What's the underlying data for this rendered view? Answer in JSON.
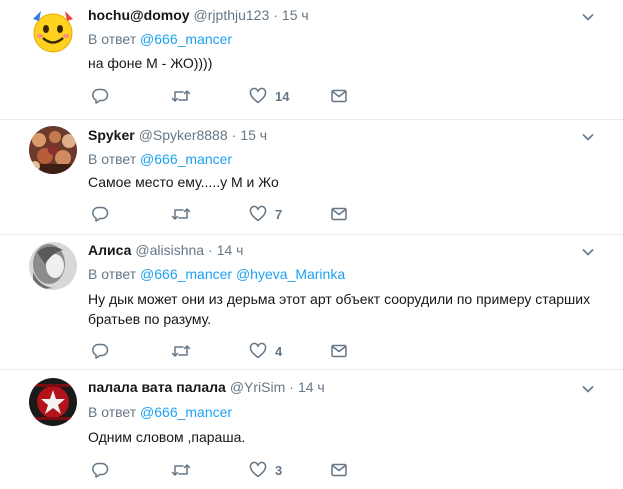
{
  "tweets": [
    {
      "name": "hochu@domoy",
      "handle": "@rjpthju123",
      "separator": "·",
      "time": "15 ч",
      "reply_prefix": "В ответ",
      "mentions": "@666_mancer",
      "text": "на фоне М - ЖО))))",
      "like_count": "14",
      "avatar_icon": "emoji-face-avatar"
    },
    {
      "name": "Spyker",
      "handle": "@Spyker8888",
      "separator": "·",
      "time": "15 ч",
      "reply_prefix": "В ответ",
      "mentions": "@666_mancer",
      "text": "Самое место ему.....у  М и Жо",
      "like_count": "7",
      "avatar_icon": "crowd-photo-avatar"
    },
    {
      "name": "Алиса",
      "handle": "@alisishna",
      "separator": "·",
      "time": "14 ч",
      "reply_prefix": "В ответ",
      "mentions": "@666_mancer @hyeva_Marinka",
      "text": "Ну дык может они из дерьма этот арт объект соорудили по примеру старших братьев по разуму.",
      "like_count": "4",
      "avatar_icon": "bw-portrait-avatar"
    },
    {
      "name": "палала вата палала",
      "handle": "@YriSim",
      "separator": "·",
      "time": "14 ч",
      "reply_prefix": "В ответ",
      "mentions": "@666_mancer",
      "text": "Одним словом ,параша.",
      "like_count": "3",
      "avatar_icon": "red-emblem-avatar"
    }
  ],
  "colors": {
    "text": "#14171a",
    "muted": "#657786",
    "link": "#1da1f2",
    "border": "#e6ecf0"
  }
}
